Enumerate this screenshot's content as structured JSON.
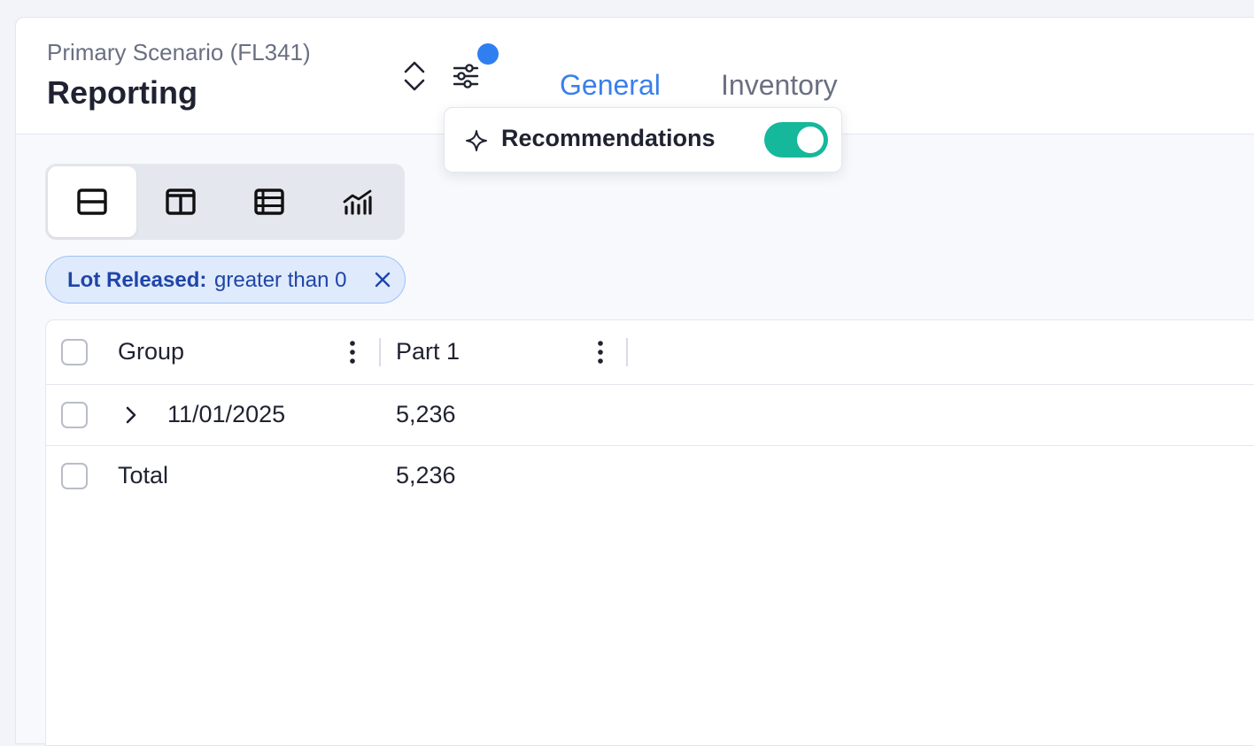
{
  "header": {
    "scenario": "Primary Scenario (FL341)",
    "title": "Reporting"
  },
  "tabs": [
    {
      "label": "General",
      "active": true
    },
    {
      "label": "Inventory",
      "active": false
    }
  ],
  "popover": {
    "label": "Recommendations",
    "enabled": true
  },
  "view_buttons": [
    {
      "name": "rows-view",
      "active": true
    },
    {
      "name": "columns-view",
      "active": false
    },
    {
      "name": "table-view",
      "active": false
    },
    {
      "name": "chart-view",
      "active": false
    }
  ],
  "filter_chip": {
    "field": "Lot Released:",
    "condition": "greater than 0"
  },
  "table": {
    "columns": [
      "Group",
      "Part 1"
    ],
    "rows": [
      {
        "group": "11/01/2025",
        "part1": "5,236",
        "expandable": true
      }
    ],
    "total": {
      "label": "Total",
      "part1": "5,236"
    }
  },
  "colors": {
    "accent": "#3a7fea",
    "toggle_on": "#15b89a",
    "chip_bg": "#dfeafc",
    "chip_text": "#1f45a8"
  }
}
